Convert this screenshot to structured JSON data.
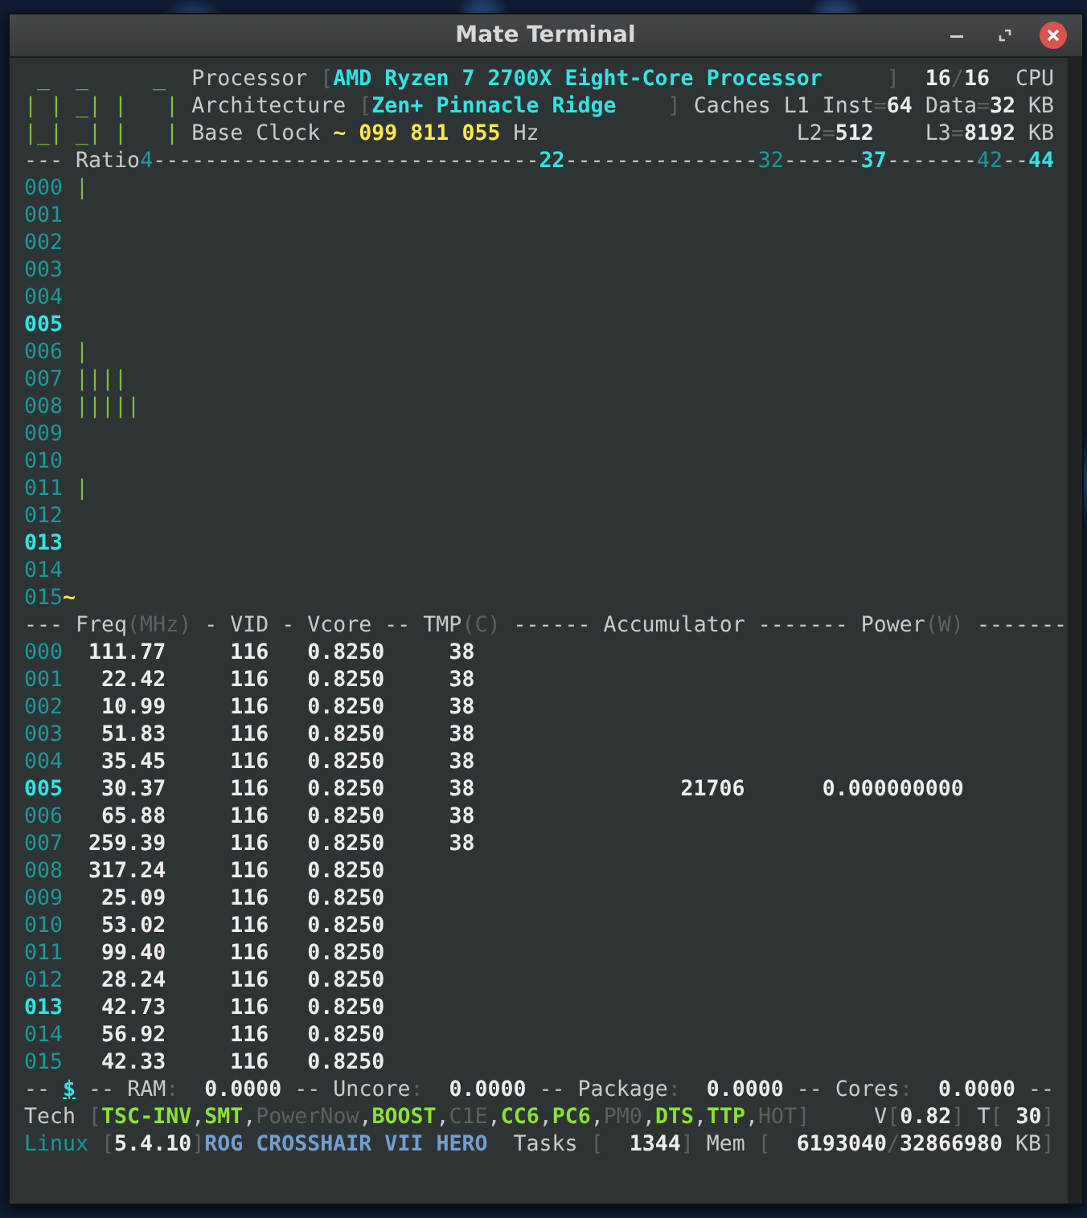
{
  "window": {
    "title": "Mate Terminal"
  },
  "terminal": {
    "lines": [
      {
        "segments": [
          {
            "text": " _  _     _  ",
            "kind": "logo"
          },
          {
            "text": "Processor ",
            "kind": "label"
          },
          {
            "text": "[",
            "kind": "dim"
          },
          {
            "text": "AMD Ryzen 7 2700X Eight-Core Processor",
            "kind": "cyan"
          },
          {
            "text": "     ]  ",
            "kind": "dim"
          },
          {
            "text": "16",
            "kind": "value"
          },
          {
            "text": "/",
            "kind": "dim"
          },
          {
            "text": "16",
            "kind": "value"
          },
          {
            "text": "  CPU",
            "kind": "label"
          }
        ]
      },
      {
        "segments": [
          {
            "text": "| | _| |   | ",
            "kind": "logo"
          },
          {
            "text": "Architecture ",
            "kind": "label"
          },
          {
            "text": "[",
            "kind": "dim"
          },
          {
            "text": "Zen+ Pinnacle Ridge",
            "kind": "cyan"
          },
          {
            "text": "    ] ",
            "kind": "dim"
          },
          {
            "text": "Caches L1 Inst",
            "kind": "label"
          },
          {
            "text": "=",
            "kind": "dim"
          },
          {
            "text": "64",
            "kind": "value"
          },
          {
            "text": " Data",
            "kind": "label"
          },
          {
            "text": "=",
            "kind": "dim"
          },
          {
            "text": "32",
            "kind": "value"
          },
          {
            "text": " KB",
            "kind": "label"
          }
        ]
      },
      {
        "segments": [
          {
            "text": "|_| _| |   | ",
            "kind": "logo"
          },
          {
            "text": "Base Clock ",
            "kind": "label"
          },
          {
            "text": "~ 099 811 055",
            "kind": "yellow"
          },
          {
            "text": " Hz                    L2",
            "kind": "label"
          },
          {
            "text": "=",
            "kind": "dim"
          },
          {
            "text": "512",
            "kind": "value"
          },
          {
            "text": "    L3",
            "kind": "label"
          },
          {
            "text": "=",
            "kind": "dim"
          },
          {
            "text": "8192",
            "kind": "value"
          },
          {
            "text": " KB",
            "kind": "label"
          }
        ]
      },
      {
        "segments": [
          {
            "text": "--- Ratio",
            "kind": "label"
          },
          {
            "text": "4",
            "kind": "teal"
          },
          {
            "text": "------------------------------",
            "kind": "label"
          },
          {
            "text": "22",
            "kind": "cyan"
          },
          {
            "text": "---------------",
            "kind": "label"
          },
          {
            "text": "32",
            "kind": "teal"
          },
          {
            "text": "------",
            "kind": "label"
          },
          {
            "text": "37",
            "kind": "cyan"
          },
          {
            "text": "-------",
            "kind": "label"
          },
          {
            "text": "42",
            "kind": "teal"
          },
          {
            "text": "--",
            "kind": "label"
          },
          {
            "text": "44",
            "kind": "cyan"
          }
        ]
      },
      {
        "segments": [
          {
            "text": "000",
            "kind": "core"
          },
          {
            "text": " |",
            "kind": "bar"
          }
        ]
      },
      {
        "segments": [
          {
            "text": "001",
            "kind": "core"
          }
        ]
      },
      {
        "segments": [
          {
            "text": "002",
            "kind": "core"
          }
        ]
      },
      {
        "segments": [
          {
            "text": "003",
            "kind": "core"
          }
        ]
      },
      {
        "segments": [
          {
            "text": "004",
            "kind": "core"
          }
        ]
      },
      {
        "segments": [
          {
            "text": "005",
            "kind": "core-hi"
          }
        ]
      },
      {
        "segments": [
          {
            "text": "006",
            "kind": "core"
          },
          {
            "text": " |",
            "kind": "bar"
          }
        ]
      },
      {
        "segments": [
          {
            "text": "007",
            "kind": "core"
          },
          {
            "text": " ||||",
            "kind": "bar"
          }
        ]
      },
      {
        "segments": [
          {
            "text": "008",
            "kind": "core"
          },
          {
            "text": " |||||",
            "kind": "bar"
          }
        ]
      },
      {
        "segments": [
          {
            "text": "009",
            "kind": "core"
          }
        ]
      },
      {
        "segments": [
          {
            "text": "010",
            "kind": "core"
          }
        ]
      },
      {
        "segments": [
          {
            "text": "011",
            "kind": "core"
          },
          {
            "text": " |",
            "kind": "bar"
          }
        ]
      },
      {
        "segments": [
          {
            "text": "012",
            "kind": "core"
          }
        ]
      },
      {
        "segments": [
          {
            "text": "013",
            "kind": "core-hi"
          }
        ]
      },
      {
        "segments": [
          {
            "text": "014",
            "kind": "core"
          }
        ]
      },
      {
        "segments": [
          {
            "text": "015",
            "kind": "core"
          },
          {
            "text": "~",
            "kind": "yellow"
          }
        ]
      },
      {
        "segments": [
          {
            "text": "--- Freq",
            "kind": "label"
          },
          {
            "text": "(MHz)",
            "kind": "dim"
          },
          {
            "text": " - VID - Vcore -- TMP",
            "kind": "label"
          },
          {
            "text": "(C)",
            "kind": "dim"
          },
          {
            "text": " ------ Accumulator ------- Power",
            "kind": "label"
          },
          {
            "text": "(W)",
            "kind": "dim"
          },
          {
            "text": " -------",
            "kind": "label"
          }
        ]
      },
      {
        "segments": [
          {
            "text": "000",
            "kind": "core"
          },
          {
            "text": "  111.77     116   0.8250     38",
            "kind": "value"
          }
        ]
      },
      {
        "segments": [
          {
            "text": "001",
            "kind": "core"
          },
          {
            "text": "   22.42     116   0.8250     38",
            "kind": "value"
          }
        ]
      },
      {
        "segments": [
          {
            "text": "002",
            "kind": "core"
          },
          {
            "text": "   10.99     116   0.8250     38",
            "kind": "value"
          }
        ]
      },
      {
        "segments": [
          {
            "text": "003",
            "kind": "core"
          },
          {
            "text": "   51.83     116   0.8250     38",
            "kind": "value"
          }
        ]
      },
      {
        "segments": [
          {
            "text": "004",
            "kind": "core"
          },
          {
            "text": "   35.45     116   0.8250     38",
            "kind": "value"
          }
        ]
      },
      {
        "segments": [
          {
            "text": "005",
            "kind": "core-hi"
          },
          {
            "text": "   30.37     116   0.8250     38                21706      0.000000000",
            "kind": "value"
          }
        ]
      },
      {
        "segments": [
          {
            "text": "006",
            "kind": "core"
          },
          {
            "text": "   65.88     116   0.8250     38",
            "kind": "value"
          }
        ]
      },
      {
        "segments": [
          {
            "text": "007",
            "kind": "core"
          },
          {
            "text": "  259.39     116   0.8250     38",
            "kind": "value"
          }
        ]
      },
      {
        "segments": [
          {
            "text": "008",
            "kind": "core"
          },
          {
            "text": "  317.24     116   0.8250",
            "kind": "value"
          }
        ]
      },
      {
        "segments": [
          {
            "text": "009",
            "kind": "core"
          },
          {
            "text": "   25.09     116   0.8250",
            "kind": "value"
          }
        ]
      },
      {
        "segments": [
          {
            "text": "010",
            "kind": "core"
          },
          {
            "text": "   53.02     116   0.8250",
            "kind": "value"
          }
        ]
      },
      {
        "segments": [
          {
            "text": "011",
            "kind": "core"
          },
          {
            "text": "   99.40     116   0.8250",
            "kind": "value"
          }
        ]
      },
      {
        "segments": [
          {
            "text": "012",
            "kind": "core"
          },
          {
            "text": "   28.24     116   0.8250",
            "kind": "value"
          }
        ]
      },
      {
        "segments": [
          {
            "text": "013",
            "kind": "core-hi"
          },
          {
            "text": "   42.73     116   0.8250",
            "kind": "value"
          }
        ]
      },
      {
        "segments": [
          {
            "text": "014",
            "kind": "core"
          },
          {
            "text": "   56.92     116   0.8250",
            "kind": "value"
          }
        ]
      },
      {
        "segments": [
          {
            "text": "015",
            "kind": "core"
          },
          {
            "text": "   42.33     116   0.8250",
            "kind": "value"
          }
        ]
      },
      {
        "segments": [
          {
            "text": "-- ",
            "kind": "label"
          },
          {
            "text": "$",
            "kind": "dollar"
          },
          {
            "text": " -- RAM",
            "kind": "label"
          },
          {
            "text": ":",
            "kind": "dim"
          },
          {
            "text": "  0.0000",
            "kind": "value"
          },
          {
            "text": " -- Uncore",
            "kind": "label"
          },
          {
            "text": ":",
            "kind": "dim"
          },
          {
            "text": "  0.0000",
            "kind": "value"
          },
          {
            "text": " -- Package",
            "kind": "label"
          },
          {
            "text": ":",
            "kind": "dim"
          },
          {
            "text": "  0.0000",
            "kind": "value"
          },
          {
            "text": " -- Cores",
            "kind": "label"
          },
          {
            "text": ":",
            "kind": "dim"
          },
          {
            "text": "  0.0000",
            "kind": "value"
          },
          {
            "text": " --",
            "kind": "label"
          }
        ]
      },
      {
        "segments": [
          {
            "text": "Tech ",
            "kind": "label"
          },
          {
            "text": "[",
            "kind": "dim"
          },
          {
            "text": "TSC-INV",
            "kind": "feature-on"
          },
          {
            "text": ",",
            "kind": "label"
          },
          {
            "text": "SMT",
            "kind": "feature-on"
          },
          {
            "text": ",",
            "kind": "label"
          },
          {
            "text": "PowerNow",
            "kind": "feature-off"
          },
          {
            "text": ",",
            "kind": "label"
          },
          {
            "text": "BOOST",
            "kind": "feature-on"
          },
          {
            "text": ",",
            "kind": "label"
          },
          {
            "text": "C1E",
            "kind": "feature-off"
          },
          {
            "text": ",",
            "kind": "label"
          },
          {
            "text": "CC6",
            "kind": "feature-on"
          },
          {
            "text": ",",
            "kind": "label"
          },
          {
            "text": "PC6",
            "kind": "feature-on"
          },
          {
            "text": ",",
            "kind": "label"
          },
          {
            "text": "PM0",
            "kind": "feature-off"
          },
          {
            "text": ",",
            "kind": "label"
          },
          {
            "text": "DTS",
            "kind": "feature-on"
          },
          {
            "text": ",",
            "kind": "label"
          },
          {
            "text": "TTP",
            "kind": "feature-on"
          },
          {
            "text": ",",
            "kind": "label"
          },
          {
            "text": "HOT",
            "kind": "feature-off"
          },
          {
            "text": "]     ",
            "kind": "dim"
          },
          {
            "text": "V",
            "kind": "label"
          },
          {
            "text": "[",
            "kind": "dim"
          },
          {
            "text": "0.82",
            "kind": "value"
          },
          {
            "text": "] ",
            "kind": "dim"
          },
          {
            "text": "T",
            "kind": "label"
          },
          {
            "text": "[ ",
            "kind": "dim"
          },
          {
            "text": "30",
            "kind": "value"
          },
          {
            "text": "]",
            "kind": "dim"
          }
        ]
      },
      {
        "segments": [
          {
            "text": "Linux",
            "kind": "teal"
          },
          {
            "text": " [",
            "kind": "dim"
          },
          {
            "text": "5.4.10",
            "kind": "value"
          },
          {
            "text": "]",
            "kind": "dim"
          },
          {
            "text": "ROG CROSSHAIR VII HERO",
            "kind": "blue"
          },
          {
            "text": "  Tasks ",
            "kind": "label"
          },
          {
            "text": "[  ",
            "kind": "dim"
          },
          {
            "text": "1344",
            "kind": "value"
          },
          {
            "text": "] ",
            "kind": "dim"
          },
          {
            "text": "Mem ",
            "kind": "label"
          },
          {
            "text": "[  ",
            "kind": "dim"
          },
          {
            "text": "6193040",
            "kind": "value"
          },
          {
            "text": "/",
            "kind": "dim"
          },
          {
            "text": "32866980",
            "kind": "value"
          },
          {
            "text": " KB",
            "kind": "label"
          },
          {
            "text": "]",
            "kind": "dim"
          }
        ]
      }
    ]
  }
}
